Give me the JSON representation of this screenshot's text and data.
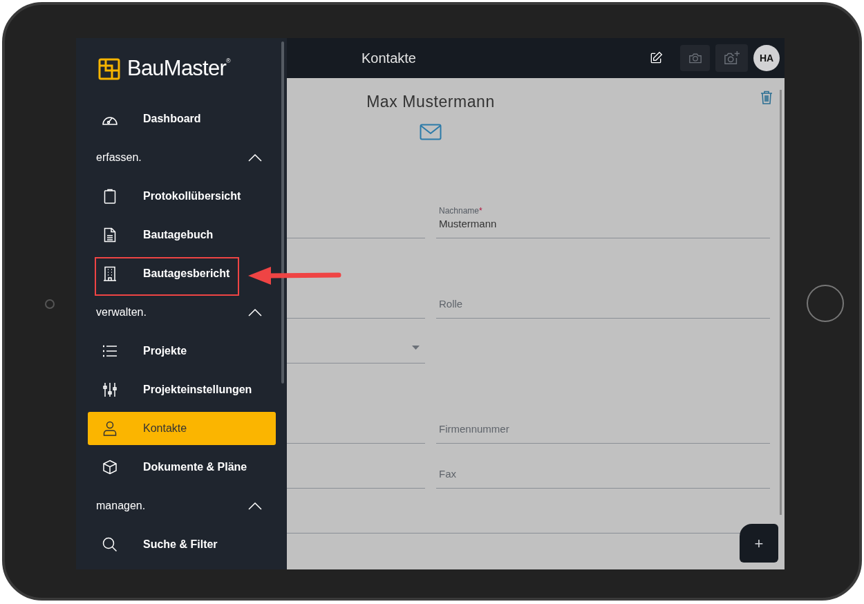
{
  "sidebar": {
    "logo": "BauMaster$^{®}$",
    "items": [
      {
        "kind": "link",
        "label": "Dashboard",
        "selected": false,
        "annotated": false
      },
      {
        "kind": "section",
        "label": "erfassen.",
        "expanded": true
      },
      {
        "kind": "link",
        "label": "Protokollübersicht",
        "selected": false,
        "annotated": false
      },
      {
        "kind": "link",
        "label": "Bautagebuch",
        "selected": false,
        "annotated": false
      },
      {
        "kind": "link",
        "label": "Bautagesbericht",
        "selected": false,
        "annotated": true
      },
      {
        "kind": "section",
        "label": "verwalten.",
        "expanded": true
      },
      {
        "kind": "link",
        "label": "Projekte",
        "selected": false,
        "annotated": false
      },
      {
        "kind": "link",
        "label": "Projekteinstellungen",
        "selected": false,
        "annotated": false
      },
      {
        "kind": "link",
        "label": "Kontakte",
        "selected": true,
        "annotated": false
      },
      {
        "kind": "link",
        "label": "Dokumente & Pläne",
        "selected": false,
        "annotated": false
      },
      {
        "kind": "section",
        "label": "managen.",
        "expanded": true
      },
      {
        "kind": "link",
        "label": "Suche & Filter",
        "selected": false,
        "annotated": false
      }
    ]
  },
  "top_bar": {
    "title": "Kontakte",
    "avatar": "HA"
  },
  "contact": {
    "name": "Max Mustermann"
  },
  "form": {
    "rows": [
      {
        "left": {
          "kind": "text"
        },
        "right": {
          "label": "Nachname",
          "required_mark": "*",
          "value": "Mustermann"
        }
      },
      {
        "left": {
          "kind": "text"
        },
        "right": {
          "placeholder": "Rolle"
        }
      },
      {
        "left": {
          "kind": "select"
        }
      },
      {
        "left": {
          "kind": "text"
        },
        "right": {
          "placeholder": "Firmennummer"
        }
      },
      {
        "left": {
          "kind": "text"
        },
        "right": {
          "placeholder": "Fax"
        }
      },
      {
        "left": {
          "kind": "wide"
        }
      }
    ]
  },
  "fab": "+"
}
